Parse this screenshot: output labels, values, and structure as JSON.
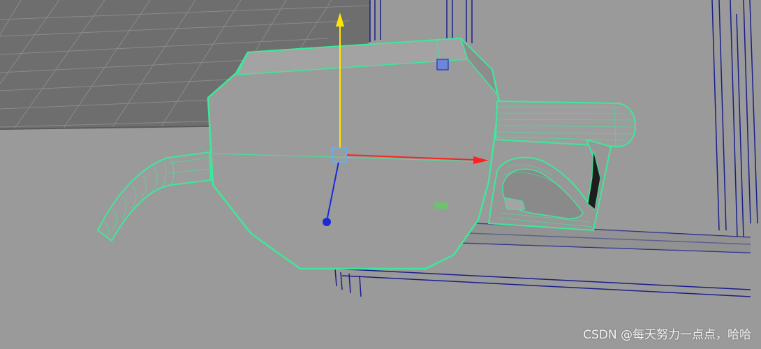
{
  "viewport": {
    "description_free": true
  },
  "colors": {
    "background": "#9a9a9a",
    "floor": "#707070",
    "grid_line": "#8c8c8c",
    "cabinet_edge": "#1a1f8a",
    "selection_wire": "#3ee89a",
    "axis_x": "#ff2020",
    "axis_y": "#ffe600",
    "axis_z": "#1a2bd4",
    "handle_center": "#5ab4ff"
  },
  "icons": {
    "move_manipulator": "move-manipulator-icon"
  },
  "watermark": {
    "text": "CSDN @每天努力一点点，哈哈"
  }
}
